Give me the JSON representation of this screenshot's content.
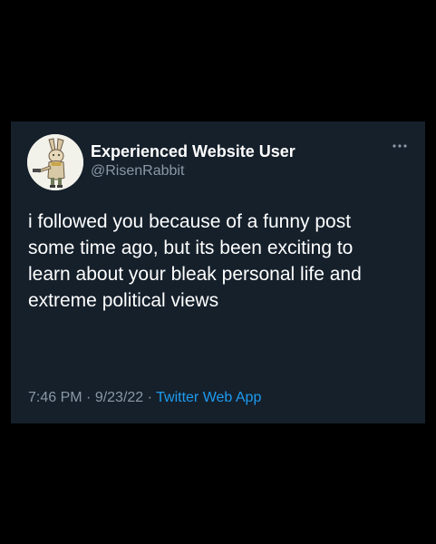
{
  "tweet": {
    "display_name": "Experienced Website User",
    "handle": "@RisenRabbit",
    "text": "i followed you because of a funny post some time ago, but its been exciting to learn about your bleak personal life and extreme political views",
    "time": "7:46 PM",
    "separator1": " · ",
    "date": "9/23/22",
    "separator2": " · ",
    "source": "Twitter Web App",
    "more_icon": "more-horizontal-icon",
    "avatar_icon": "rabbit-avatar"
  },
  "colors": {
    "background": "#000000",
    "card": "#15202b",
    "text": "#ffffff",
    "secondary": "#8b98a5",
    "accent": "#1d9bf0"
  }
}
